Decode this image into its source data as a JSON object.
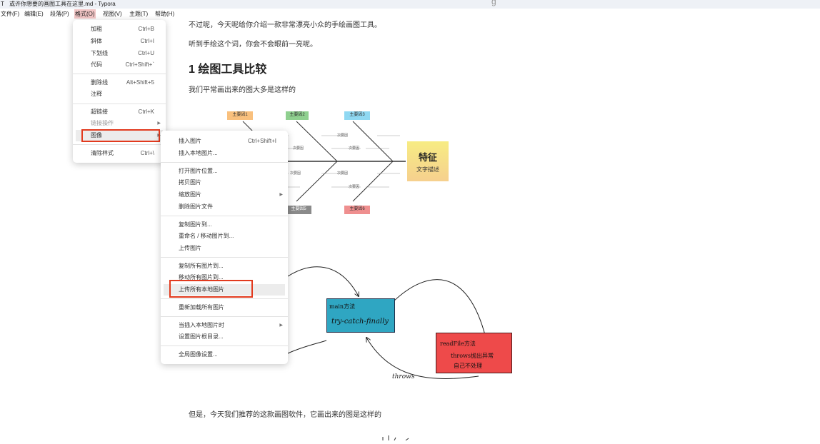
{
  "window": {
    "app_icon": "T",
    "title": "或许你想要的画图工具在这里.md - Typora",
    "trailing_glyph": "g"
  },
  "menubar": {
    "items": [
      {
        "label": "文件(F)"
      },
      {
        "label": "编辑(E)"
      },
      {
        "label": "段落(P)"
      },
      {
        "label": "格式(O)",
        "active": true
      },
      {
        "label": "视图(V)"
      },
      {
        "label": "主题(T)"
      },
      {
        "label": "帮助(H)"
      }
    ]
  },
  "format_menu": {
    "items": [
      {
        "label": "加粗",
        "shortcut": "Ctrl+B"
      },
      {
        "label": "斜体",
        "shortcut": "Ctrl+I"
      },
      {
        "label": "下划线",
        "shortcut": "Ctrl+U"
      },
      {
        "label": "代码",
        "shortcut": "Ctrl+Shift+`"
      },
      {
        "label": "删除线",
        "shortcut": "Alt+Shift+5"
      },
      {
        "label": "注释",
        "shortcut": ""
      },
      {
        "label": "超链接",
        "shortcut": "Ctrl+K"
      },
      {
        "label": "链接操作",
        "shortcut": "",
        "submenu": true,
        "disabled": true
      },
      {
        "label": "图像",
        "shortcut": "",
        "submenu": true,
        "highlighted": true
      },
      {
        "label": "清除样式",
        "shortcut": "Ctrl+\\"
      }
    ]
  },
  "image_submenu": {
    "items": [
      {
        "label": "插入图片",
        "shortcut": "Ctrl+Shift+I"
      },
      {
        "label": "插入本地图片...",
        "shortcut": ""
      },
      {
        "label": "打开图片位置...",
        "shortcut": ""
      },
      {
        "label": "拷贝图片",
        "shortcut": ""
      },
      {
        "label": "缩放图片",
        "shortcut": "",
        "submenu": true
      },
      {
        "label": "删除图片文件",
        "shortcut": ""
      },
      {
        "label": "复制图片到...",
        "shortcut": ""
      },
      {
        "label": "重命名 / 移动图片到...",
        "shortcut": ""
      },
      {
        "label": "上传图片",
        "shortcut": ""
      },
      {
        "label": "复制所有图片到...",
        "shortcut": ""
      },
      {
        "label": "移动所有图片到...",
        "shortcut": ""
      },
      {
        "label": "上传所有本地图片",
        "shortcut": "",
        "highlighted": true
      },
      {
        "label": "重新加载所有图片",
        "shortcut": ""
      },
      {
        "label": "当插入本地图片时",
        "shortcut": "",
        "submenu": true
      },
      {
        "label": "设置图片根目录...",
        "shortcut": ""
      },
      {
        "label": "全局图像设置...",
        "shortcut": ""
      }
    ]
  },
  "document": {
    "para1": "不过呢，今天呢给你介绍一款非常漂亮小众的手绘画图工具。",
    "para2": "听到手绘这个词，你会不会眼前一亮呢。",
    "heading": "1 绘图工具比较",
    "para3": "我们平常画出来的图大多是这样的",
    "para4": "但是，今天我们推荐的这款画图软件，它画出来的图是这样的"
  },
  "fishbone": {
    "main_causes": [
      "主要因1",
      "主要因2",
      "主要因3",
      "主要因5",
      "主要因6"
    ],
    "sub_cause": "次要因",
    "feature_title": "特征",
    "feature_desc": "文字描述",
    "colors": {
      "c1": "#f9c07d",
      "c2": "#8fd08f",
      "c3": "#8fd8f2",
      "c5": "#8a8a8a",
      "c6": "#ef8f8f",
      "feature": "#f5e08a"
    }
  },
  "flowchart": {
    "main_title": "main方法",
    "main_body": "try-catch-finally",
    "readfile_title": "readFile方法",
    "readfile_line2": "throws抛出异常",
    "readfile_line3": "自己不处理",
    "edge_label": "throws",
    "colors": {
      "main": "#2fa6c2",
      "readfile": "#ee4a4a"
    }
  },
  "accents": {
    "menu_active": "#f1c5c5",
    "red_box": "#e23a1e"
  }
}
